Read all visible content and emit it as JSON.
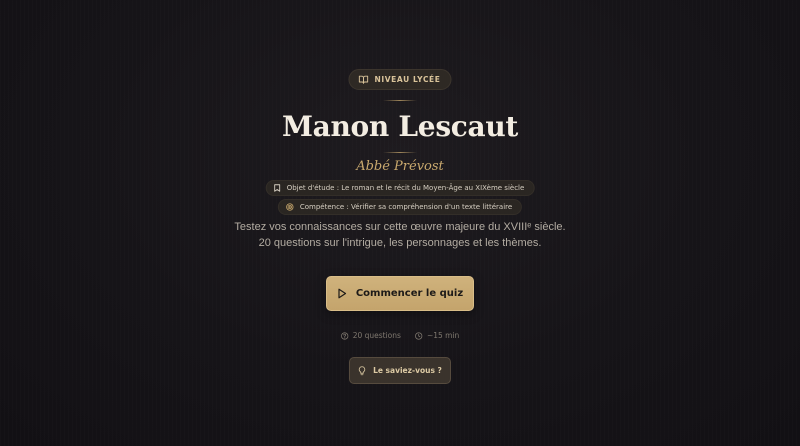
{
  "badge": {
    "icon": "book-open-icon",
    "label": "NIVEAU LYCÉE"
  },
  "title": "Manon Lescaut",
  "author": "Abbé Prévost",
  "chips": [
    {
      "icon": "bookmark-icon",
      "label": "Objet d'étude : Le roman et le récit du Moyen-Âge au XIXème siècle"
    },
    {
      "icon": "target-icon",
      "label": "Compétence : Vérifier sa compréhension d'un texte littéraire"
    }
  ],
  "intro": {
    "line1": "Testez vos connaissances sur cette œuvre majeure du XVIIIᵉ siècle.",
    "line2": "20 questions sur l'intrigue, les personnages et les thèmes."
  },
  "start_button": {
    "icon": "play-icon",
    "label": "Commencer le quiz"
  },
  "meta": {
    "questions": {
      "icon": "help-circle-icon",
      "label": "20 questions"
    },
    "duration": {
      "icon": "clock-icon",
      "label": "~15 min"
    }
  },
  "fact_button": {
    "icon": "lightbulb-icon",
    "label": "Le saviez-vous ?"
  },
  "colors": {
    "accent": "#c9a96e",
    "background": "#161418",
    "title": "#f3ede2"
  }
}
